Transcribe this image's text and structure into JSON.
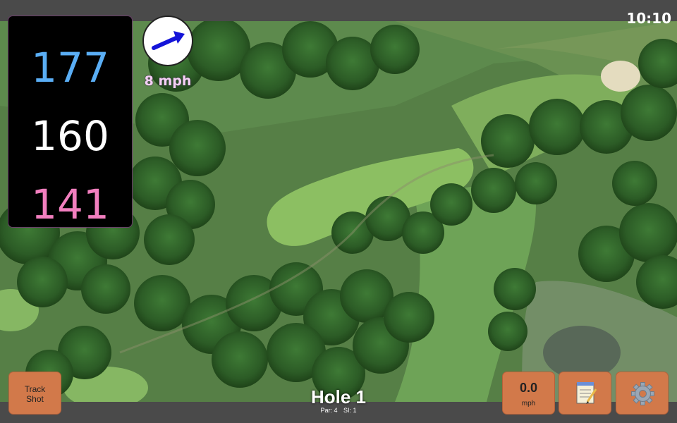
{
  "status_bar": {
    "time": "10:10"
  },
  "yardage": {
    "back": "177",
    "center": "160",
    "front": "141"
  },
  "wind": {
    "speed_label": "8 mph",
    "direction_icon": "arrow-right-up-icon"
  },
  "hole": {
    "title": "Hole 1",
    "par": "Par: 4",
    "si": "SI: 1"
  },
  "buttons": {
    "track_shot": "Track\nShot",
    "wind_value": "0.0",
    "wind_unit": "mph",
    "notes_icon": "notepad-icon",
    "settings_icon": "gear-icon"
  },
  "colors": {
    "back_yardage": "#5aaef5",
    "center_yardage": "#ffffff",
    "front_yardage": "#f27fbf",
    "button": "#d2794a"
  }
}
